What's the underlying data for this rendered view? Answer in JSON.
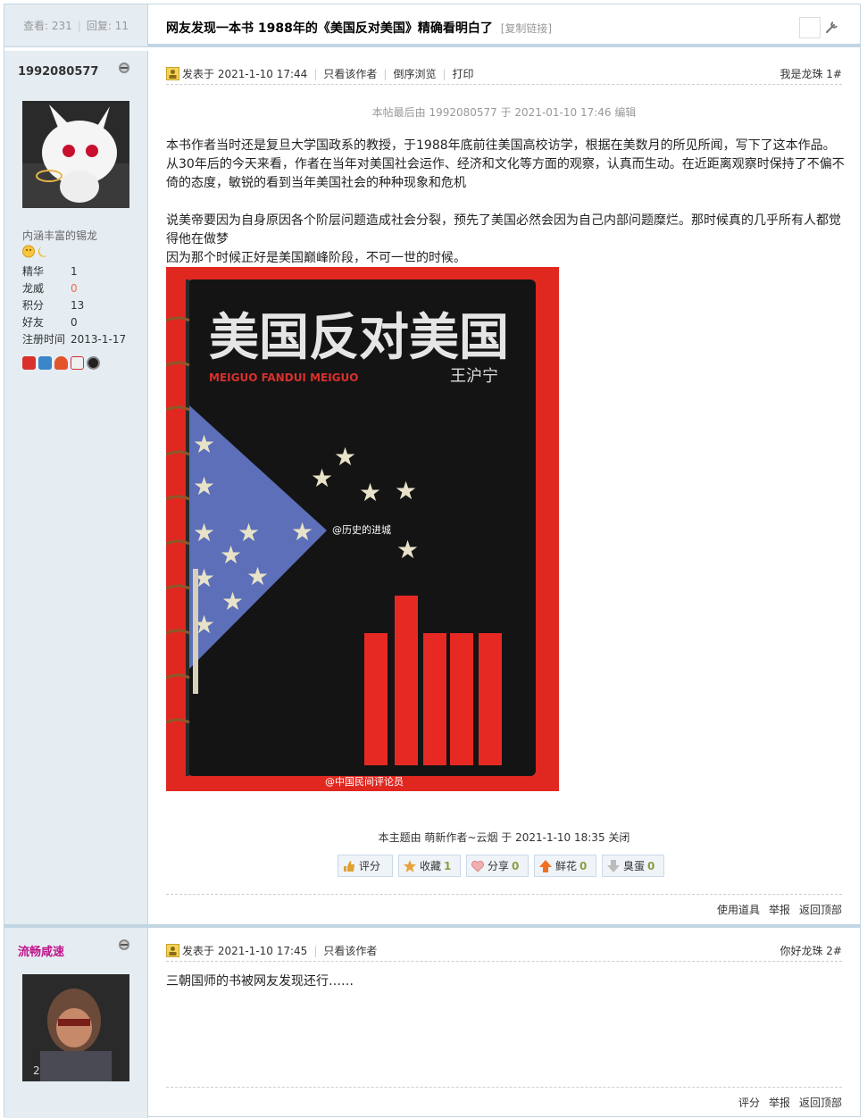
{
  "header": {
    "views_label": "查看: 231",
    "replies_label": "回复: 11",
    "title": "网友发现一本书 1988年的《美国反对美国》精确看明白了",
    "copy_link": "[复制链接]"
  },
  "posts": [
    {
      "author": "1992080577",
      "rank_title": "内涵丰富的锡龙",
      "stats": [
        {
          "k": "精华",
          "v": "1"
        },
        {
          "k": "龙威",
          "v": "0"
        },
        {
          "k": "积分",
          "v": "13"
        },
        {
          "k": "好友",
          "v": "0"
        },
        {
          "k": "注册时间",
          "v": "2013-1-17"
        }
      ],
      "meta": {
        "posted": "发表于 2021-1-10 17:44",
        "only_author": "只看该作者",
        "reverse": "倒序浏览",
        "print": "打印",
        "floor": "我是龙珠 1#"
      },
      "edited": "本帖最后由 1992080577 于 2021-01-10 17:46 编辑",
      "paragraphs": [
        "本书作者当时还是复旦大学国政系的教授，于1988年底前往美国高校访学，根据在美数月的所见所闻，写下了这本作品。从30年后的今天来看，作者在当年对美国社会运作、经济和文化等方面的观察，认真而生动。在近距离观察时保持了不偏不倚的态度，敏锐的看到当年美国社会的种种现象和危机",
        "说美帝要因为自身原因各个阶层问题造成社会分裂，预先了美国必然会因为自己内部问题糜烂。那时候真的几乎所有人都觉得他在做梦",
        "因为那个时候正好是美国巅峰阶段，不可一世的时候。"
      ],
      "book": {
        "title": "美国反对美国",
        "pinyin": "MEIGUO FANDUI MEIGUO",
        "author": "王沪宁",
        "watermark1": "@历史的进城",
        "watermark2": "@中国民间评论员"
      },
      "closed_notice": "本主题由 萌新作者~云烟 于 2021-1-10 18:35 关闭",
      "rate_buttons": [
        {
          "label": "评分",
          "count": "",
          "color": "#e0a030"
        },
        {
          "label": "收藏",
          "count": "1",
          "color": "#e8a23a"
        },
        {
          "label": "分享",
          "count": "0",
          "color": "#e89a9a"
        },
        {
          "label": "鲜花",
          "count": "0",
          "color": "#f07020"
        },
        {
          "label": "臭蛋",
          "count": "0",
          "color": "#aaaaaa"
        }
      ],
      "footer": {
        "use_tool": "使用道具",
        "report": "举报",
        "top": "返回顶部"
      }
    },
    {
      "author": "流畅咸速",
      "meta": {
        "posted": "发表于 2021-1-10 17:45",
        "only_author": "只看该作者",
        "floor": "你好龙珠 2#"
      },
      "body": "三朝国师的书被网友发现还行……",
      "avatar_badge": "2",
      "footer": {
        "rate": "评分",
        "report": "举报",
        "top": "返回顶部"
      }
    }
  ]
}
